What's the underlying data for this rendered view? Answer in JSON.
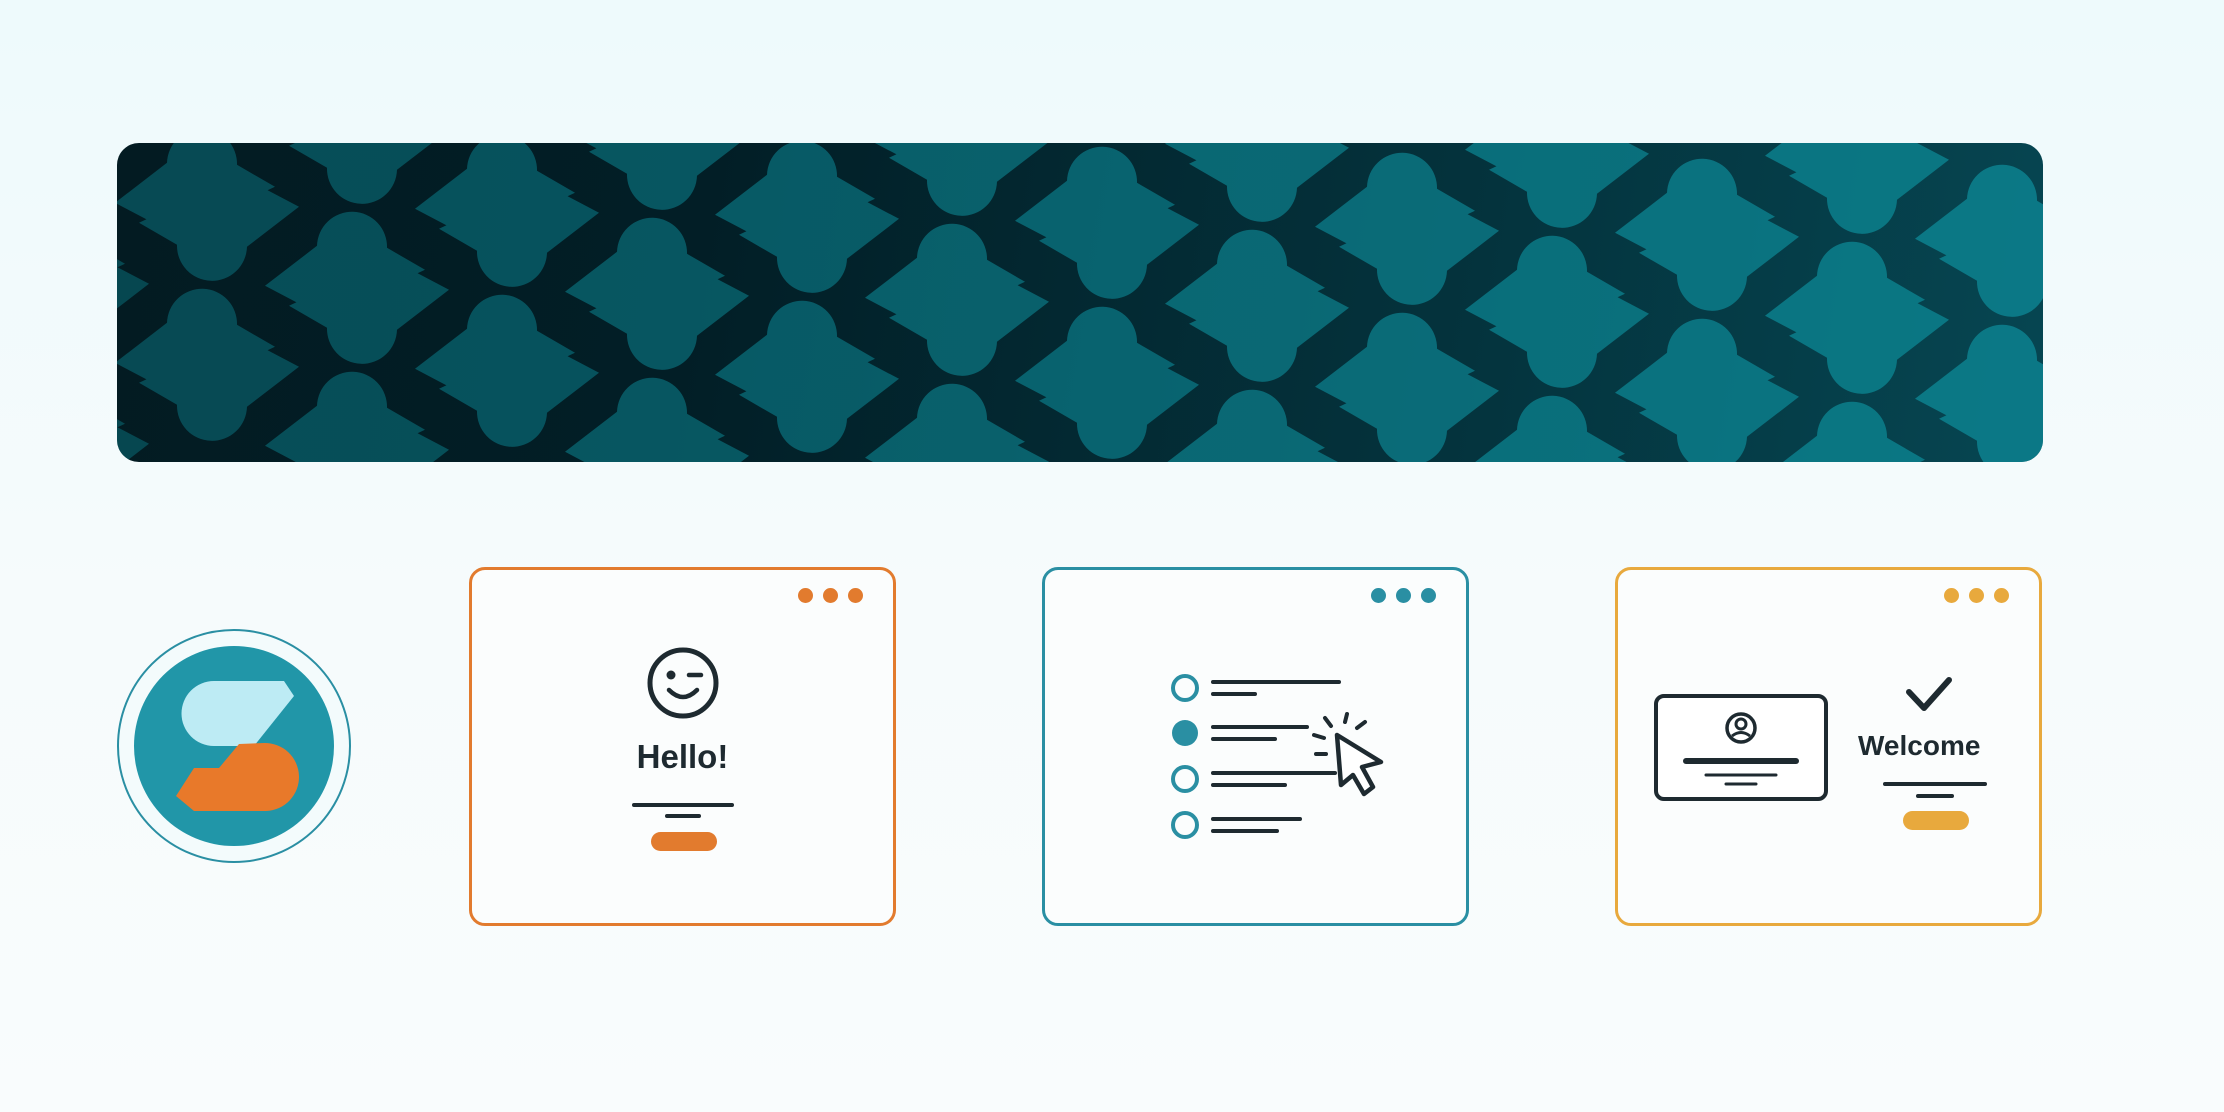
{
  "banner": {
    "pattern": "teal-s-logo-pattern",
    "colors": {
      "dark": "#021e26",
      "motif": "#0c7f8c"
    }
  },
  "logo": {
    "icon": "s-logo-icon",
    "colors": {
      "ring": "#2a8fa3",
      "circle": "#2196a8",
      "light": "#bdebf4",
      "accent": "#e8792a"
    }
  },
  "cards": [
    {
      "id": "hello",
      "heading": "Hello!",
      "icon": "winking-face-icon",
      "accent": "#e27b2e"
    },
    {
      "id": "list",
      "icon": "cursor-click-icon",
      "accent": "#2a8fa3"
    },
    {
      "id": "welcome",
      "heading": "Welcome",
      "icon": "checkmark-icon",
      "accent": "#e8a93d"
    }
  ]
}
